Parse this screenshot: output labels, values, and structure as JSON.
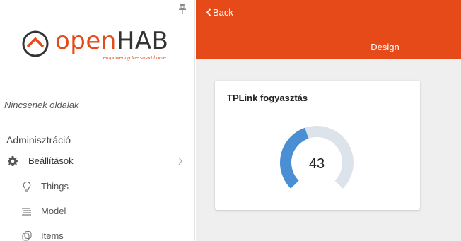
{
  "sidebar": {
    "logo": {
      "text_open": "open",
      "text_hab": "HAB",
      "tagline": "empowering the smart home"
    },
    "no_pages": "Nincsenek oldalak",
    "section_title": "Adminisztráció",
    "items": [
      {
        "label": "Beállítások",
        "icon": "gear-icon"
      },
      {
        "label": "Things",
        "icon": "lightbulb-icon"
      },
      {
        "label": "Model",
        "icon": "list-icon"
      },
      {
        "label": "Items",
        "icon": "items-icon"
      }
    ]
  },
  "header": {
    "back_label": "Back",
    "title": "Design"
  },
  "card": {
    "title": "TPLink fogyasztás",
    "gauge_value": "43",
    "gauge_fraction": 0.43
  },
  "colors": {
    "accent": "#e64a19",
    "gauge_fill": "#4a8fd4",
    "gauge_track": "#dde3ea",
    "main_bg": "#efefef"
  }
}
